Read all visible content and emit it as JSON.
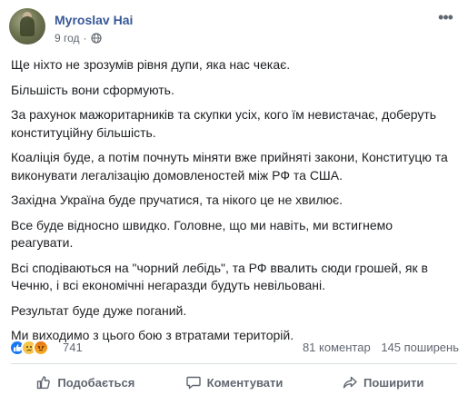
{
  "post": {
    "author": "Myroslav Hai",
    "time": "9 год",
    "separator": "·",
    "paragraphs": [
      "Ще ніхто не зрозумів рівня дупи, яка нас чекає.",
      "Більшість вони сформують.",
      "За рахунок мажоритарників та скупки усіх, кого їм невистачає, доберуть конституційну більшість.",
      "Коаліція буде, а потім почнуть міняти вже прийняті закони, Конституцю та виконувати легалізацію домовленостей між РФ та США.",
      "Західна Україна буде пручатися, та нікого це не хвилює.",
      "Все буде відносно швидко. Головне, що ми навіть, ми встигнемо реагувати.",
      "Всі сподіваються на \"чорний лебідь\", та РФ ввалить сюди грошей, як в Чечню, і всі економічні негаразди будуть невільовані.",
      "Результат буде дуже поганий.",
      "Ми виходимо з цього бою з втратами територій."
    ]
  },
  "reactions": {
    "count": "741",
    "comments": "81 коментар",
    "shares": "145 поширень",
    "icons": [
      "like-icon",
      "sad-icon",
      "angry-icon"
    ]
  },
  "actions": {
    "like": "Подобається",
    "comment": "Коментувати",
    "share": "Поширити"
  },
  "colors": {
    "link": "#385898",
    "text": "#1c1e21",
    "muted": "#606770",
    "like": "#1877f2"
  }
}
